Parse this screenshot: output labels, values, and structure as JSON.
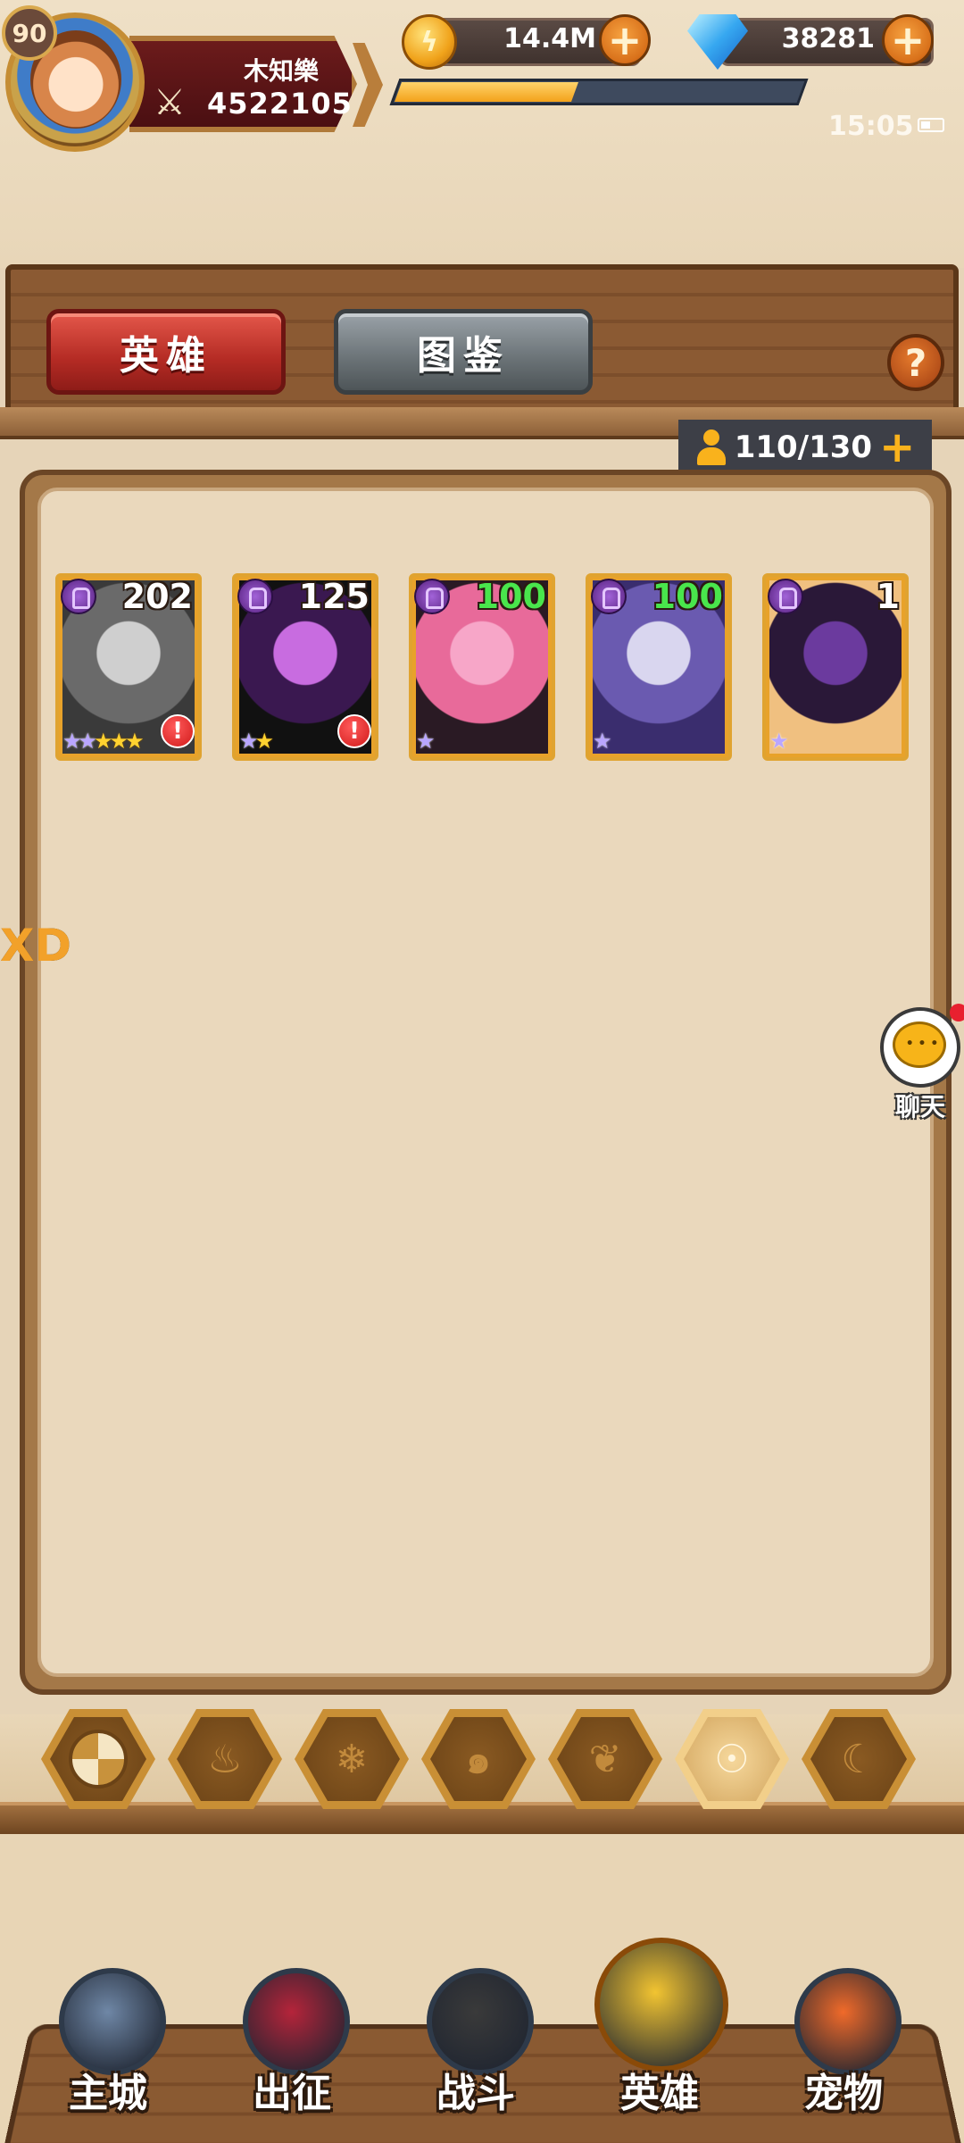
{
  "player": {
    "level": "90",
    "name": "木知樂",
    "power": "4522105",
    "exp_progress_percent": 44
  },
  "resources": {
    "gold": "14.4M",
    "gems": "38281"
  },
  "status_bar": {
    "time": "15:05"
  },
  "tabs": [
    {
      "label": "英雄",
      "active": true
    },
    {
      "label": "图鉴",
      "active": false
    }
  ],
  "help": {
    "label": "?"
  },
  "capacity": {
    "value": "110/130",
    "plus": "+"
  },
  "heroes": [
    {
      "level": "202",
      "level_color": "white",
      "purple_stars": 2,
      "gold_stars": 3,
      "alert": "!",
      "art": [
        "#cfcfcf",
        "#6a6a6a",
        "#3a3a3a"
      ]
    },
    {
      "level": "125",
      "level_color": "white",
      "purple_stars": 1,
      "gold_stars": 1,
      "alert": "!",
      "art": [
        "#c86ce0",
        "#3a1850",
        "#111111"
      ]
    },
    {
      "level": "100",
      "level_color": "green",
      "purple_stars": 1,
      "gold_stars": 0,
      "alert": "",
      "art": [
        "#f7a6c8",
        "#e86a9a",
        "#2a1a24"
      ]
    },
    {
      "level": "100",
      "level_color": "green",
      "purple_stars": 1,
      "gold_stars": 0,
      "alert": "",
      "art": [
        "#d9d6ef",
        "#6a5ab0",
        "#3a2d6e"
      ]
    },
    {
      "level": "1",
      "level_color": "white",
      "purple_stars": 1,
      "gold_stars": 0,
      "alert": "",
      "art": [
        "#6b3a9e",
        "#2a1838",
        "#f0c080"
      ]
    }
  ],
  "side_text": "XD",
  "chat": {
    "label": "聊天"
  },
  "filters": [
    {
      "name": "all",
      "glyph": ""
    },
    {
      "name": "fire",
      "glyph": "♨"
    },
    {
      "name": "ice",
      "glyph": "❄"
    },
    {
      "name": "wind",
      "glyph": "๑"
    },
    {
      "name": "nature",
      "glyph": "❦"
    },
    {
      "name": "light",
      "glyph": "☉",
      "active": true
    },
    {
      "name": "dark",
      "glyph": "☾"
    }
  ],
  "nav": [
    {
      "label": "主城",
      "icon": "castle-icon",
      "color": "#6f87a6"
    },
    {
      "label": "出征",
      "icon": "expedition-icon",
      "color": "#b5243a"
    },
    {
      "label": "战斗",
      "icon": "battle-icon",
      "color": "#3a3a3a"
    },
    {
      "label": "英雄",
      "icon": "hero-icon",
      "color": "#f2c431",
      "active": true
    },
    {
      "label": "宠物",
      "icon": "pet-icon",
      "color": "#f06a2a"
    }
  ]
}
